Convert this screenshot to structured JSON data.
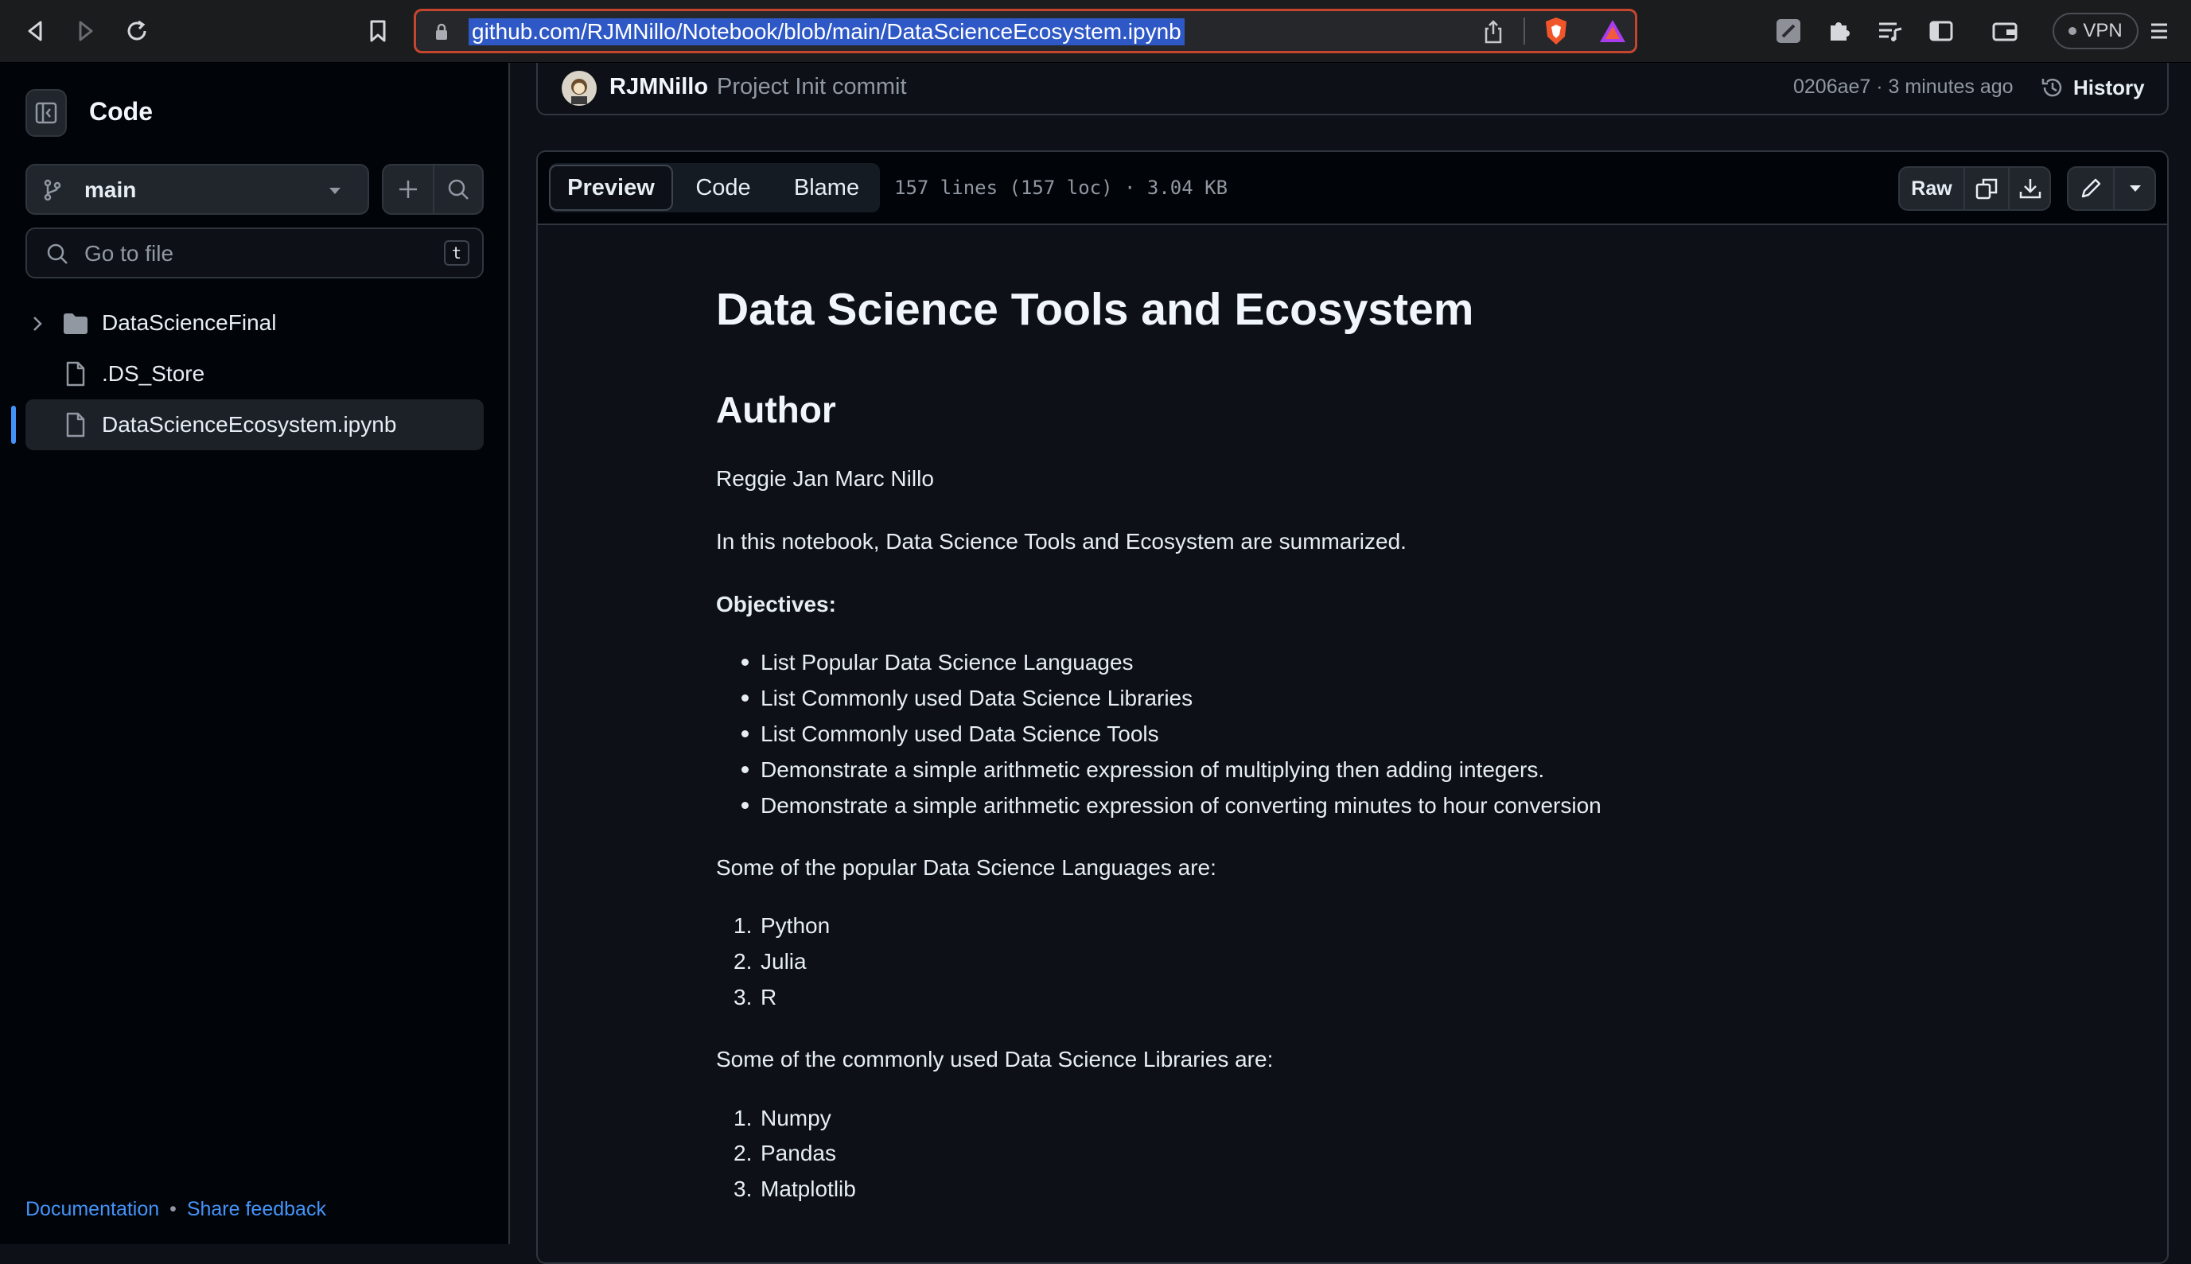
{
  "browser": {
    "url": "github.com/RJMNillo/Notebook/blob/main/DataScienceEcosystem.ipynb",
    "vpn_label": "VPN"
  },
  "sidebar": {
    "title": "Code",
    "branch": "main",
    "search_placeholder": "Go to file",
    "shortcut_key": "t",
    "tree": [
      {
        "name": "DataScienceFinal",
        "type": "folder"
      },
      {
        "name": ".DS_Store",
        "type": "file"
      },
      {
        "name": "DataScienceEcosystem.ipynb",
        "type": "file",
        "selected": true
      }
    ],
    "footer": {
      "documentation": "Documentation",
      "separator": "•",
      "feedback": "Share feedback"
    }
  },
  "commit": {
    "author": "RJMNillo",
    "message": "Project Init commit",
    "sha_time": "0206ae7 · 3 minutes ago",
    "history_label": "History"
  },
  "file_header": {
    "tabs": [
      "Preview",
      "Code",
      "Blame"
    ],
    "active_tab": "Preview",
    "meta": "157 lines (157 loc) · 3.04 KB",
    "raw_label": "Raw"
  },
  "notebook": {
    "title": "Data Science Tools and Ecosystem",
    "author_heading": "Author",
    "author_name": "Reggie Jan Marc Nillo",
    "intro": "In this notebook, Data Science Tools and Ecosystem are summarized.",
    "objectives_heading": "Objectives:",
    "objectives": [
      "List Popular Data Science Languages",
      "List Commonly used Data Science Libraries",
      "List Commonly used Data Science Tools",
      "Demonstrate a simple arithmetic expression of multiplying then adding integers.",
      "Demonstrate a simple arithmetic expression of converting minutes to hour conversion"
    ],
    "languages_intro": "Some of the popular Data Science Languages are:",
    "languages": [
      "Python",
      "Julia",
      "R"
    ],
    "libraries_intro": "Some of the commonly used Data Science Libraries are:",
    "libraries": [
      "Numpy",
      "Pandas",
      "Matplotlib"
    ]
  },
  "colors": {
    "background": "#0d1117",
    "sidebar_bg": "#010409",
    "border": "#30363d",
    "link": "#4493f8",
    "selection": "#2e58c5",
    "url_border": "#c6452f"
  }
}
